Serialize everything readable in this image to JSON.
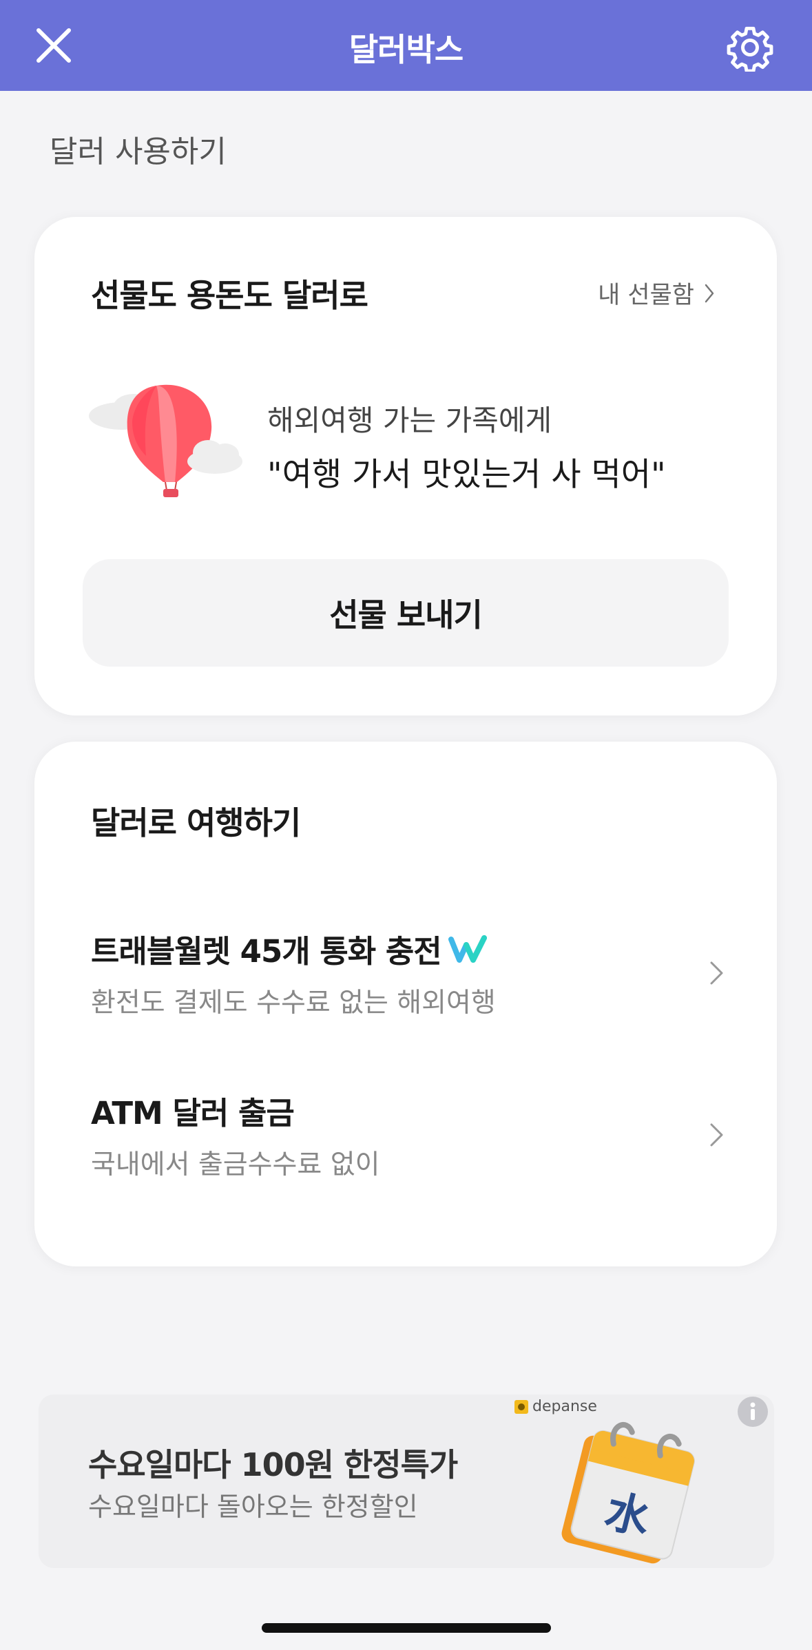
{
  "header": {
    "title": "달러박스",
    "close_icon": "close-icon",
    "settings_icon": "gear-icon"
  },
  "section_label": "달러 사용하기",
  "gift_card": {
    "title": "선물도 용돈도 달러로",
    "gift_box_link": "내 선물함",
    "illustration": "hot-air-balloon",
    "description_line1": "해외여행 가는 가족에게",
    "description_line2": "\"여행 가서 맛있는거 사 먹어\"",
    "send_button": "선물 보내기"
  },
  "travel_card": {
    "title": "달러로 여행하기",
    "items": [
      {
        "title": "트래블월렛 45개 통화 충전",
        "subtitle": "환전도 결제도 수수료 없는 해외여행",
        "badge_icon": "travelwallet-logo-icon"
      },
      {
        "title": "ATM 달러 출금",
        "subtitle": "국내에서 출금수수료 없이"
      }
    ]
  },
  "banner": {
    "brand": "depanse",
    "title": "수요일마다 100원 한정특가",
    "subtitle": "수요일마다 돌아오는 한정할인",
    "calendar_glyph": "水",
    "info_icon": "info-icon"
  },
  "colors": {
    "header_bg": "#6a71d8",
    "background": "#f4f4f6",
    "card_bg": "#ffffff",
    "button_bg": "#f4f4f5"
  }
}
